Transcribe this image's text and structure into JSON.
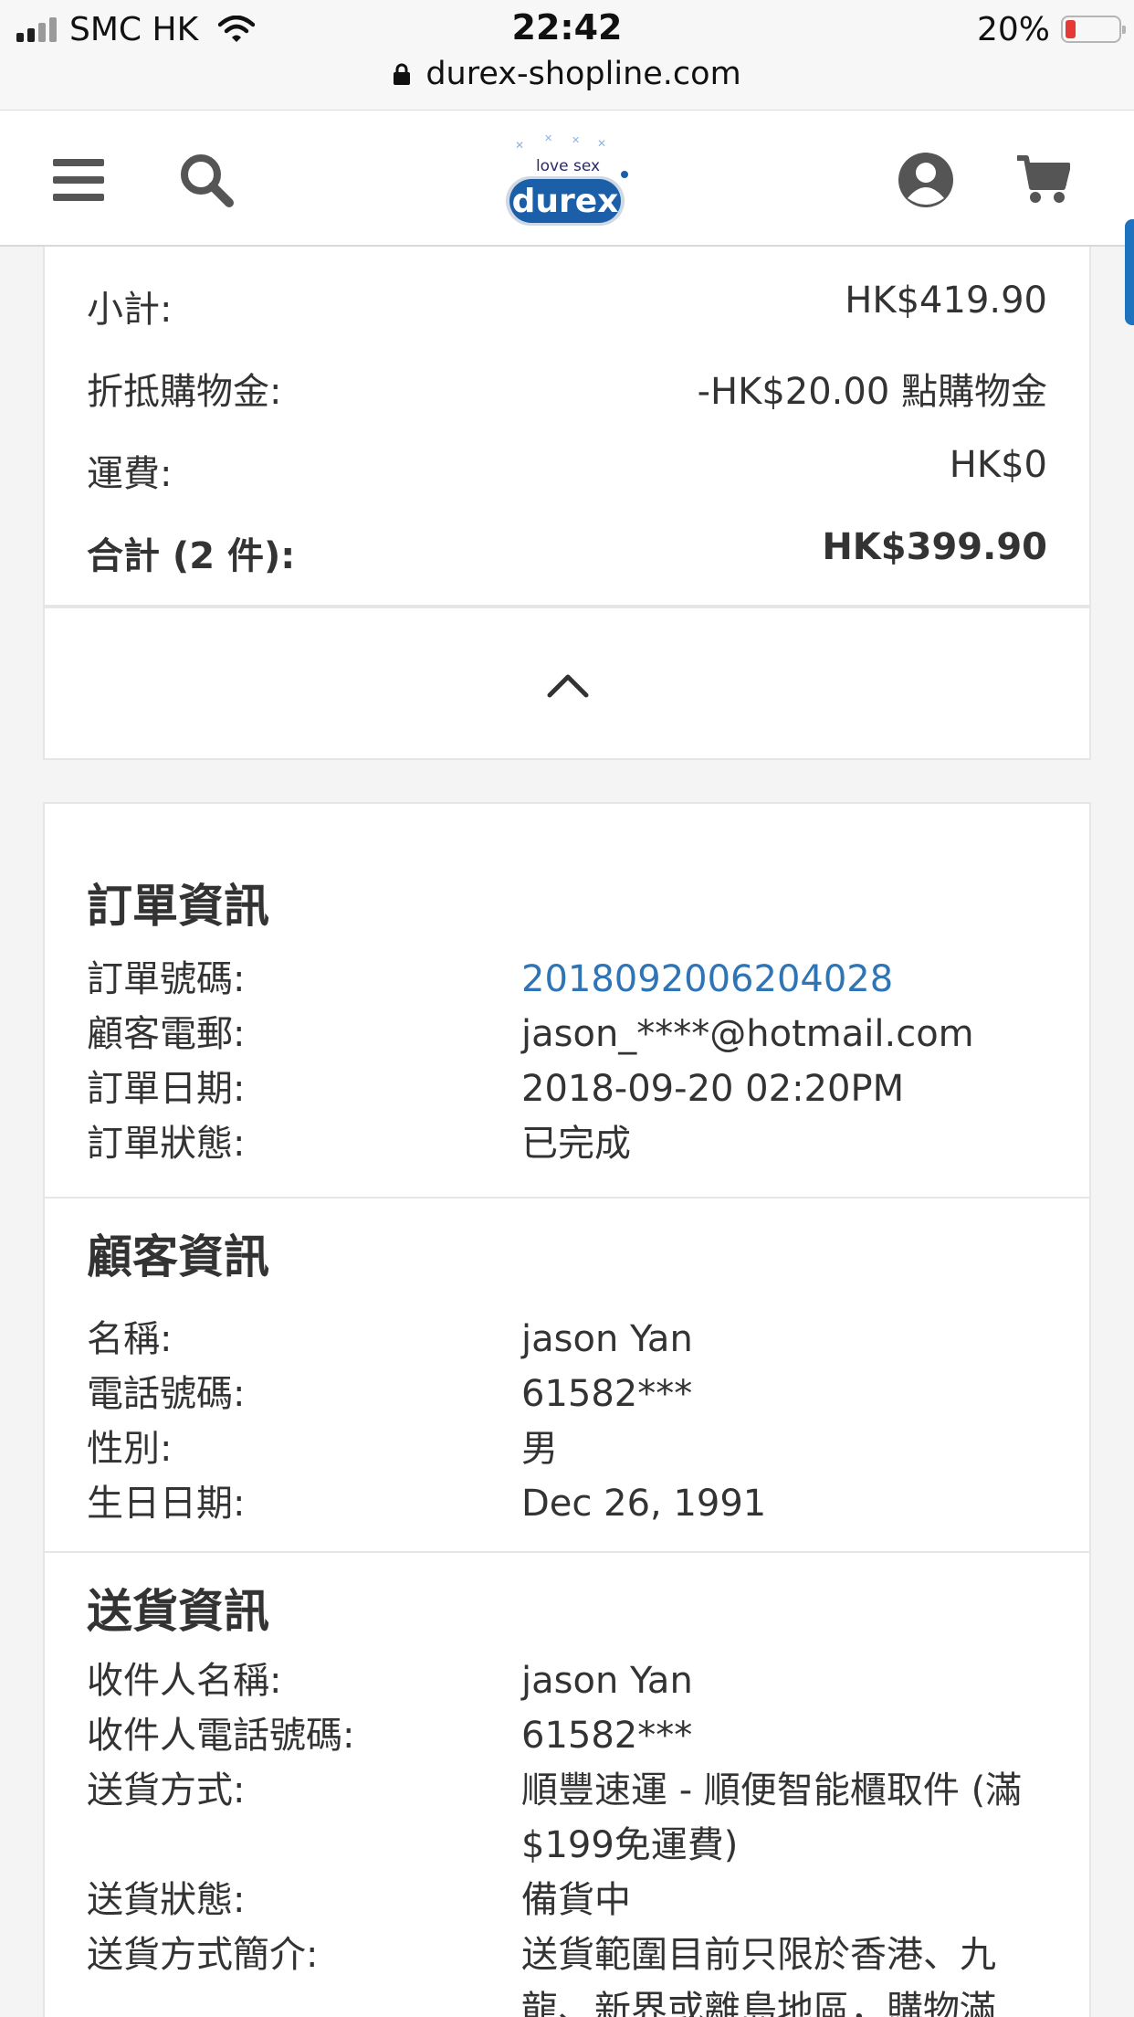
{
  "status_bar": {
    "carrier": "SMC HK",
    "time": "22:42",
    "battery_percent_label": "20%",
    "battery_level": 0.2,
    "url": "durex-shopline.com"
  },
  "header": {
    "logo_top_text": "love sex",
    "logo_text": "durex"
  },
  "summary": {
    "subtotal_label": "小計:",
    "subtotal_value": "HK$419.90",
    "credit_label": "折抵購物金:",
    "credit_value": "-HK$20.00 點購物金",
    "shipping_label": "運費:",
    "shipping_value": "HK$0",
    "total_label": "合計 (2 件):",
    "total_value": "HK$399.90"
  },
  "order_info": {
    "title": "訂單資訊",
    "order_no_label": "訂單號碼:",
    "order_no_value": "2018092006204028",
    "email_label": "顧客電郵:",
    "email_value": "jason_****@hotmail.com",
    "date_label": "訂單日期:",
    "date_value": "2018-09-20 02:20PM",
    "status_label": "訂單狀態:",
    "status_value": "已完成"
  },
  "customer_info": {
    "title": "顧客資訊",
    "name_label": "名稱:",
    "name_value": "jason Yan",
    "phone_label": "電話號碼:",
    "phone_value": "61582***",
    "gender_label": "性別:",
    "gender_value": "男",
    "birthday_label": "生日日期:",
    "birthday_value": "Dec 26, 1991"
  },
  "delivery_info": {
    "title": "送貨資訊",
    "recipient_name_label": "收件人名稱:",
    "recipient_name_value": "jason Yan",
    "recipient_phone_label": "收件人電話號碼:",
    "recipient_phone_value": "61582***",
    "method_label": "送貨方式:",
    "method_value_line1": "順豐速運 - 順便智能櫃取件 (滿",
    "method_value_line2": "$199免運費)",
    "status_label": "送貨狀態:",
    "status_value": "備貨中",
    "desc_label": "送貨方式簡介:",
    "desc_value_line1": "送貨範圍目前只限於香港、九",
    "desc_value_line2": "龍、新界或離島地區，購物滿"
  },
  "colors": {
    "link": "#2f74b5",
    "brand_blue": "#1a5fa8",
    "accent_tab": "#1e73be",
    "battery_low": "#e53935"
  }
}
